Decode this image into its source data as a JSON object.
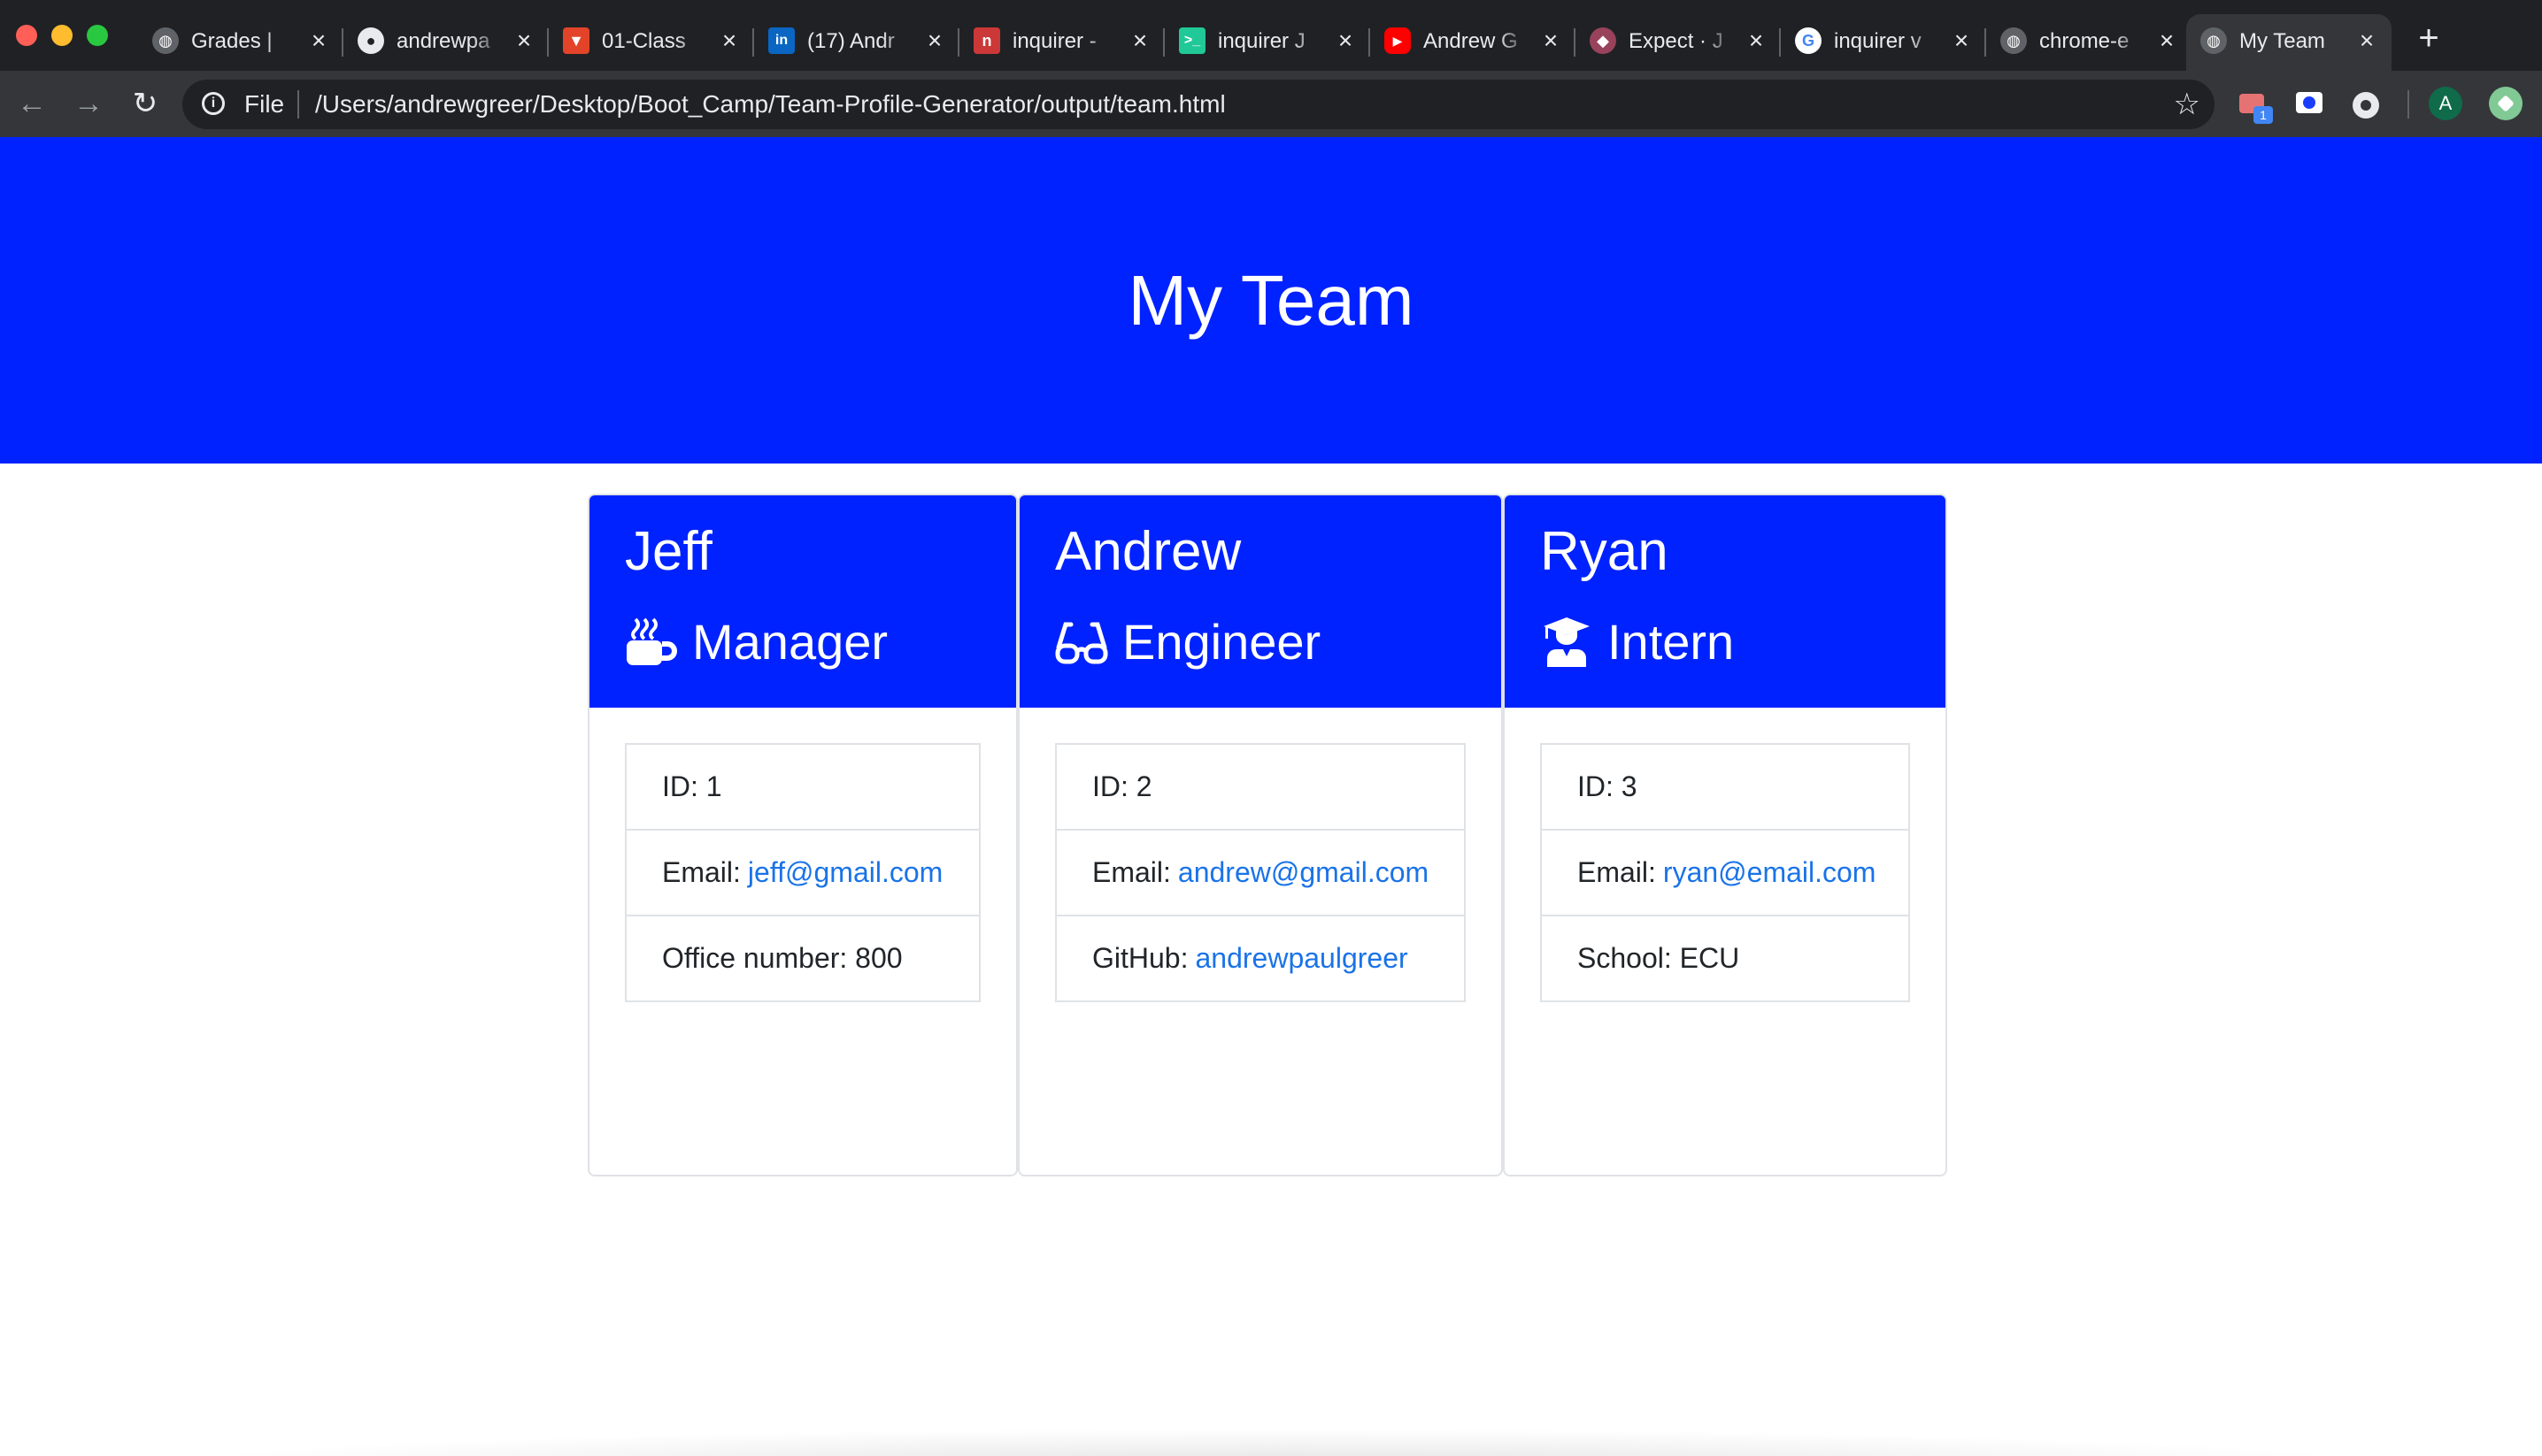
{
  "browser": {
    "tabs": [
      {
        "title": "Grades |",
        "favicon": "globe-icon"
      },
      {
        "title": "andrewpa",
        "favicon": "github-icon"
      },
      {
        "title": "01-Class",
        "favicon": "gitlab-icon"
      },
      {
        "title": "(17) Andr",
        "favicon": "linkedin-icon"
      },
      {
        "title": "inquirer -",
        "favicon": "npm-icon"
      },
      {
        "title": "inquirer J",
        "favicon": "terminal-icon"
      },
      {
        "title": "Andrew G",
        "favicon": "youtube-icon"
      },
      {
        "title": "Expect · J",
        "favicon": "jest-icon"
      },
      {
        "title": "inquirer v",
        "favicon": "google-icon"
      },
      {
        "title": "chrome-e",
        "favicon": "globe-icon"
      },
      {
        "title": "My Team",
        "favicon": "globe-icon",
        "active": true
      }
    ],
    "close_glyph": "×",
    "new_tab_glyph": "+",
    "address": {
      "scheme_label": "File",
      "url": "/Users/andrewgreer/Desktop/Boot_Camp/Team-Profile-Generator/output/team.html"
    },
    "extension_badge": "1",
    "profile_initial": "A"
  },
  "page": {
    "title": "My Team",
    "colors": {
      "header_blue": "#0022ff",
      "link": "#1a73e8",
      "border": "#dfe2e6"
    },
    "cards": [
      {
        "name": "Jeff",
        "role": "Manager",
        "icon": "mug-icon",
        "id_label": "ID: 1",
        "email_label": "Email:",
        "email": "jeff@gmail.com",
        "extra_label": "Office number: 800",
        "extra_link": ""
      },
      {
        "name": "Andrew",
        "role": "Engineer",
        "icon": "glasses-icon",
        "id_label": "ID: 2",
        "email_label": "Email:",
        "email": "andrew@gmail.com",
        "extra_label": "GitHub:",
        "extra_link": "andrewpaulgreer"
      },
      {
        "name": "Ryan",
        "role": "Intern",
        "icon": "graduate-icon",
        "id_label": "ID: 3",
        "email_label": "Email:",
        "email": "ryan@email.com",
        "extra_label": "School: ECU",
        "extra_link": ""
      }
    ]
  }
}
